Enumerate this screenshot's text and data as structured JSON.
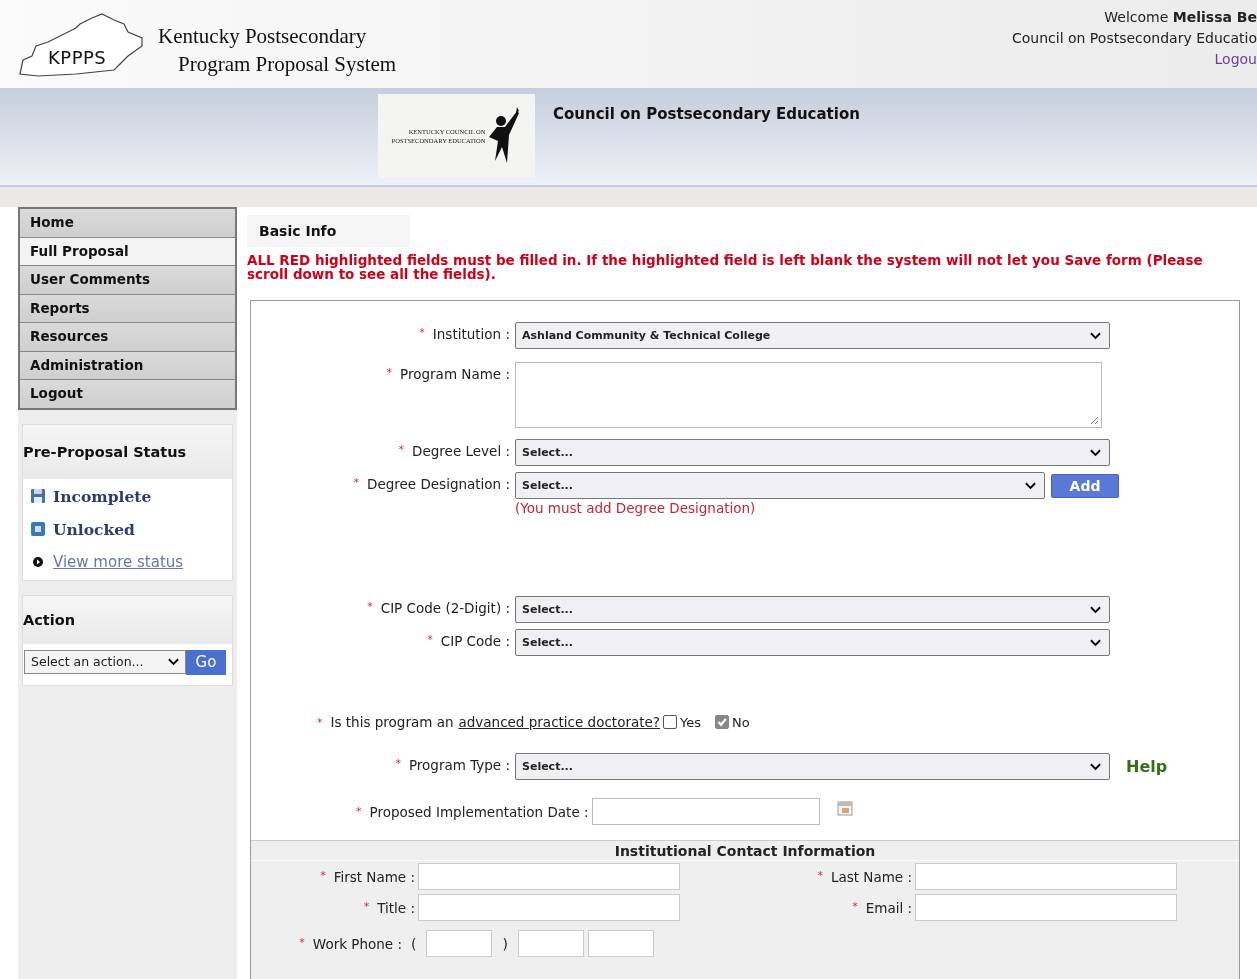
{
  "header": {
    "logo_text": "KPPPS",
    "title_line1": "Kentucky Postsecondary",
    "title_line2": "Program Proposal System",
    "welcome_label": "Welcome",
    "user_name": "Melissa Be",
    "organization": "Council on Postsecondary Educatio",
    "logout_link": "Logou"
  },
  "banner": {
    "logo_lines": [
      "KENTUCKY COUNCIL ON",
      "POSTSECONDARY EDUCATION"
    ],
    "title": "Council on Postsecondary Education"
  },
  "sidebar": {
    "nav": [
      {
        "label": "Home",
        "selected": false
      },
      {
        "label": "Full Proposal",
        "selected": true
      },
      {
        "label": "User Comments",
        "selected": false
      },
      {
        "label": "Reports",
        "selected": false
      },
      {
        "label": "Resources",
        "selected": false
      },
      {
        "label": "Administration",
        "selected": false
      },
      {
        "label": "Logout",
        "selected": false
      }
    ],
    "status_panel": {
      "title": "Pre-Proposal Status",
      "items": [
        {
          "kind": "save",
          "label": "Incomplete"
        },
        {
          "kind": "lock",
          "label": "Unlocked"
        },
        {
          "kind": "link",
          "label": "View more status"
        }
      ]
    },
    "action_panel": {
      "title": "Action",
      "select_value": "Select an action...",
      "button": "Go"
    }
  },
  "tabs": [
    {
      "label": "Basic Info",
      "selected": true
    }
  ],
  "notice": "ALL RED highlighted fields must be filled in. If the highlighted field is left blank the system will not let you Save form (Please scroll down to see all the fields).",
  "form": {
    "fields": [
      {
        "kind": "select",
        "mark": "*",
        "label": "Institution :",
        "value": "Ashland Community & Technical College"
      },
      {
        "kind": "textarea",
        "mark": "*",
        "label": "Program Name :"
      },
      {
        "kind": "select",
        "mark": "*",
        "label": "Degree Level :",
        "value": "Select..."
      },
      {
        "kind": "select_add",
        "mark": "*",
        "label": "Degree Designation :",
        "value": "Select...",
        "button": "Add",
        "note": "(You must add Degree Designation)"
      },
      {
        "kind": "select",
        "mark": "*",
        "label": "CIP Code (2-Digit) :",
        "value": "Select..."
      },
      {
        "kind": "select",
        "mark": "*",
        "label": "CIP Code :",
        "value": "Select..."
      },
      {
        "kind": "question",
        "mark": "*",
        "text": "Is this program an",
        "link": "advanced practice doctorate?",
        "options": [
          {
            "label": "Yes",
            "checked": false
          },
          {
            "label": "No",
            "checked": true
          }
        ]
      },
      {
        "kind": "select_help",
        "mark": "*",
        "label": "Program Type :",
        "value": "Select...",
        "link": "Help"
      },
      {
        "kind": "date",
        "mark": "*",
        "label": "Proposed Implementation Date :"
      }
    ],
    "contact": {
      "title": "Institutional Contact Information",
      "fields": [
        {
          "kind": "text",
          "mark": "*",
          "label": "First Name :"
        },
        {
          "kind": "text",
          "mark": "*",
          "label": "Last Name :"
        },
        {
          "kind": "text",
          "mark": "*",
          "label": "Title :"
        },
        {
          "kind": "text",
          "mark": "*",
          "label": "Email :"
        },
        {
          "kind": "phone",
          "mark": "*",
          "label": "Work Phone :",
          "open": "(",
          "close": ")"
        }
      ]
    }
  }
}
